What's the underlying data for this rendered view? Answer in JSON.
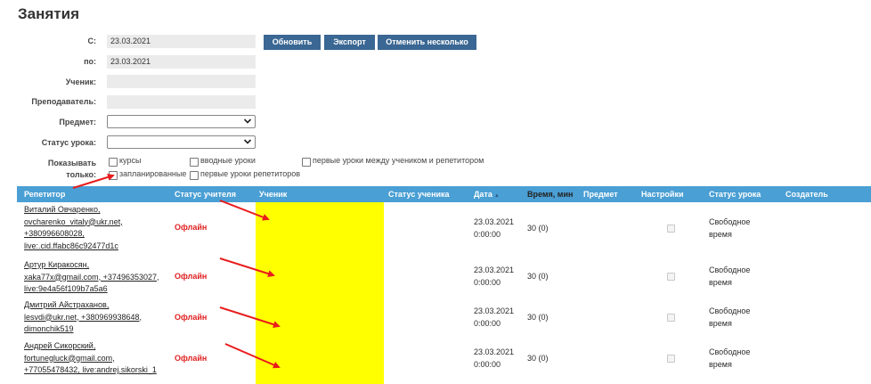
{
  "page": {
    "title": "Занятия"
  },
  "filters": {
    "from_label": "С:",
    "from_value": "23.03.2021",
    "to_label": "по:",
    "to_value": "23.03.2021",
    "student_label": "Ученик:",
    "student_value": "",
    "teacher_label": "Преподаватель:",
    "teacher_value": "",
    "subject_label": "Предмет:",
    "subject_value": "",
    "status_label": "Статус урока:",
    "status_value": "",
    "show_only_label_1": "Показывать",
    "show_only_label_2": "только:"
  },
  "buttons": {
    "refresh": "Обновить",
    "export": "Экспорт",
    "cancel_several": "Отменить несколько"
  },
  "checkboxes": [
    {
      "label": "курсы",
      "checked": false
    },
    {
      "label": "вводные уроки",
      "checked": false
    },
    {
      "label": "первые уроки между учеником и репетитором",
      "checked": false
    },
    {
      "label": "запланированные",
      "checked": false
    },
    {
      "label": "первые уроки репетиторов",
      "checked": false
    }
  ],
  "table": {
    "columns": [
      "Репетитор",
      "Статус учителя",
      "Ученик",
      "Статус ученика",
      "Дата",
      "Время, мин",
      "Предмет",
      "Настройки",
      "Статус урока",
      "Создатель"
    ],
    "sort_indicator": "▲",
    "rows": [
      {
        "tutor_lines": [
          "Виталий Овчаренко,",
          "ovcharenko_vitaly@ukr.net,",
          "+380996608028,",
          "live:.cid.ffabc86c92477d1c"
        ],
        "teacher_status": "Офлайн",
        "date": "23.03.2021",
        "time": "0:00:00",
        "minutes": "30 (0)",
        "lesson_status_1": "Свободное",
        "lesson_status_2": "время"
      },
      {
        "tutor_lines": [
          "Артур Киракосян,",
          "xaka77x@gmail.com, +37496353027,",
          "live:9e4a56f109b7a5a6"
        ],
        "teacher_status": "Офлайн",
        "date": "23.03.2021",
        "time": "0:00:00",
        "minutes": "30 (0)",
        "lesson_status_1": "Свободное",
        "lesson_status_2": "время"
      },
      {
        "tutor_lines": [
          "Дмитрий Айстраханов,",
          "lesvdi@ukr.net, +380969938648,",
          "dimonchik519"
        ],
        "teacher_status": "Офлайн",
        "date": "23.03.2021",
        "time": "0:00:00",
        "minutes": "30 (0)",
        "lesson_status_1": "Свободное",
        "lesson_status_2": "время"
      },
      {
        "tutor_lines": [
          "Андрей Сикорский,",
          "fortunegluck@gmail.com,",
          "+77055478432, live:andrej.sikorski_1"
        ],
        "teacher_status": "Офлайн",
        "date": "23.03.2021",
        "time": "0:00:00",
        "minutes": "30 (0)",
        "lesson_status_1": "Свободное",
        "lesson_status_2": "время"
      }
    ]
  },
  "colors": {
    "header_bar": "#4a9fd4",
    "button": "#3a6793",
    "offline": "#e02020",
    "highlight": "#ffff00",
    "arrow": "#e81c1c"
  }
}
